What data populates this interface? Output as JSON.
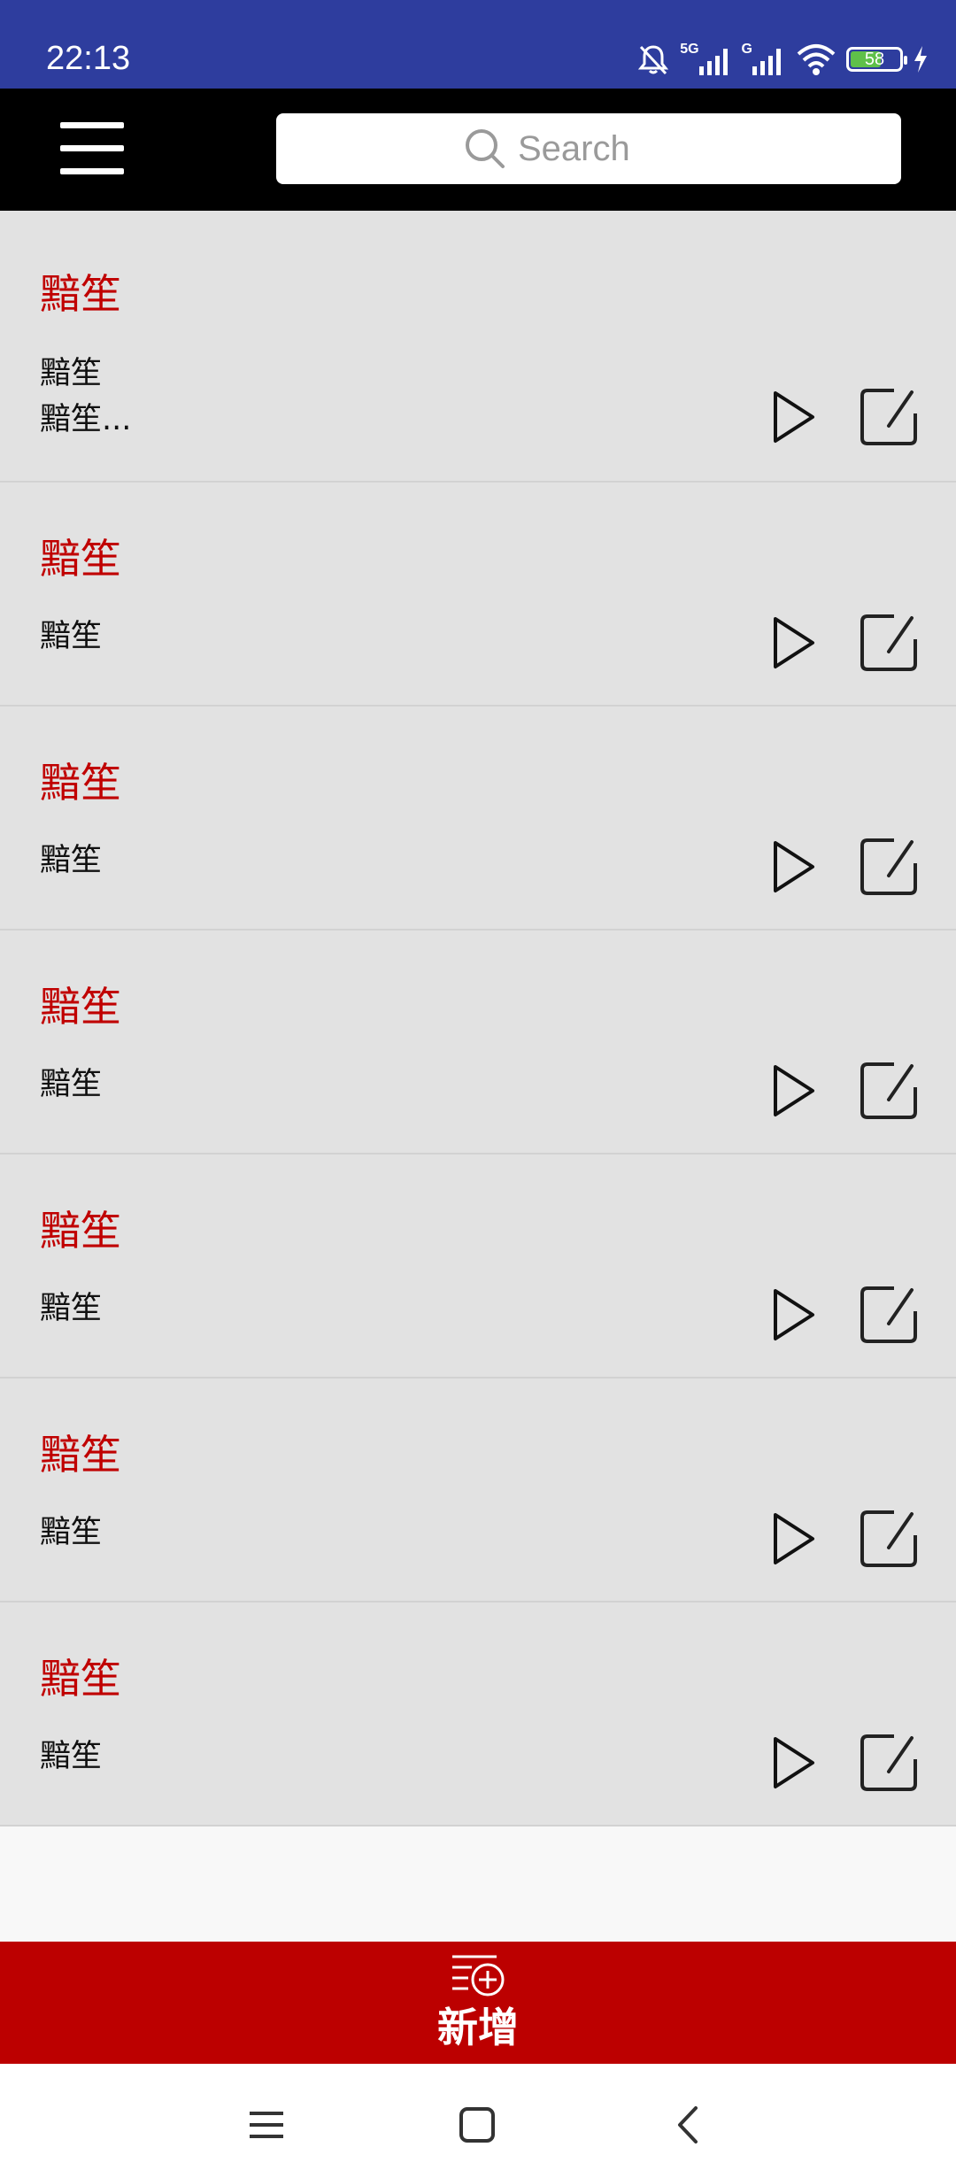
{
  "status_bar": {
    "time": "22:13",
    "network_labels": [
      "5G",
      "G"
    ],
    "battery_level": "58",
    "icons": [
      "bell-muted-icon",
      "signal-icon",
      "signal-icon",
      "wifi-icon",
      "battery-icon",
      "charging-icon"
    ]
  },
  "toolbar": {
    "menu_icon": "hamburger-menu-icon",
    "search": {
      "placeholder": "Search",
      "icon": "search-icon"
    }
  },
  "items": [
    {
      "title": "黯笙",
      "subtitle_lines": [
        "黯笙",
        "黯笙..."
      ]
    },
    {
      "title": "黯笙",
      "subtitle_lines": [
        "黯笙"
      ]
    },
    {
      "title": "黯笙",
      "subtitle_lines": [
        "黯笙"
      ]
    },
    {
      "title": "黯笙",
      "subtitle_lines": [
        "黯笙"
      ]
    },
    {
      "title": "黯笙",
      "subtitle_lines": [
        "黯笙"
      ]
    },
    {
      "title": "黯笙",
      "subtitle_lines": [
        "黯笙"
      ]
    },
    {
      "title": "黯笙",
      "subtitle_lines": [
        "黯笙"
      ]
    }
  ],
  "item_actions": {
    "play_icon": "play-icon",
    "edit_icon": "edit-icon"
  },
  "add_button": {
    "label": "新增",
    "icon": "add-to-list-icon"
  },
  "nav_bar": {
    "icons": [
      "recents-icon",
      "home-icon",
      "back-icon"
    ]
  },
  "colors": {
    "status_bar": "#2e3d9e",
    "toolbar": "#000000",
    "accent_red": "#bc0000",
    "title_red": "#c00000",
    "row_bg": "#e2e2e2"
  }
}
